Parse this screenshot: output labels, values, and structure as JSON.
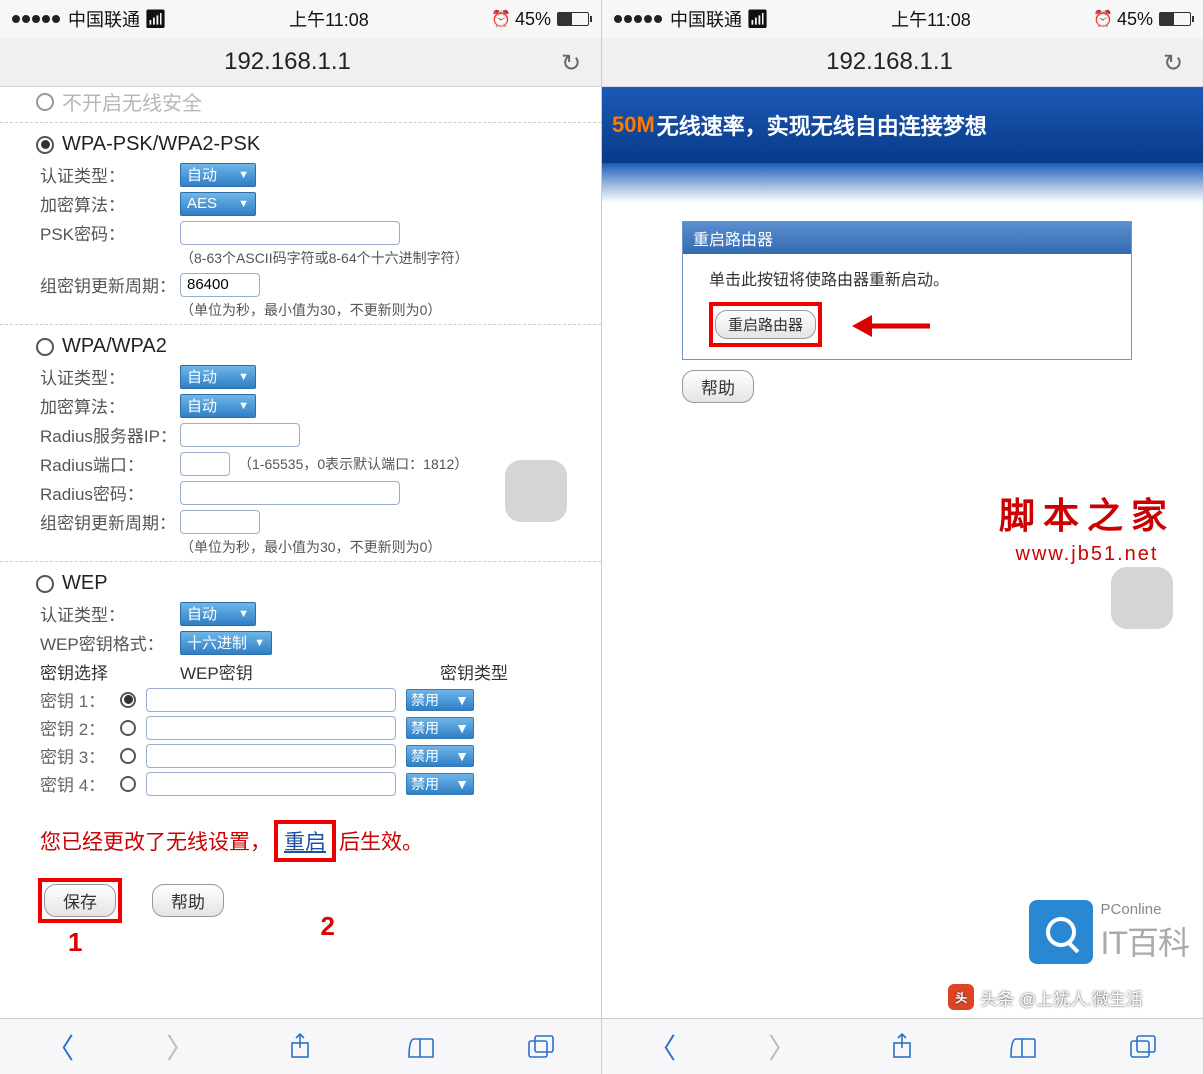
{
  "status": {
    "carrier": "中国联通",
    "time": "上午11:08",
    "battery": "45%",
    "alarm": "⏰"
  },
  "url": "192.168.1.1",
  "left": {
    "top_disabled": "不开启无线安全",
    "wpa_psk": {
      "title": "WPA-PSK/WPA2-PSK",
      "auth_label": "认证类型：",
      "auth_value": "自动",
      "enc_label": "加密算法：",
      "enc_value": "AES",
      "psk_label": "PSK密码：",
      "psk_value": "",
      "psk_hint": "（8-63个ASCII码字符或8-64个十六进制字符）",
      "group_label": "组密钥更新周期：",
      "group_value": "86400",
      "group_hint": "（单位为秒，最小值为30，不更新则为0）"
    },
    "wpa": {
      "title": "WPA/WPA2",
      "auth_label": "认证类型：",
      "auth_value": "自动",
      "enc_label": "加密算法：",
      "enc_value": "自动",
      "radius_ip_label": "Radius服务器IP：",
      "radius_ip_value": "",
      "radius_port_label": "Radius端口：",
      "radius_port_value": "",
      "radius_port_hint": "（1-65535，0表示默认端口：1812）",
      "radius_pw_label": "Radius密码：",
      "group_label": "组密钥更新周期：",
      "group_hint": "（单位为秒，最小值为30，不更新则为0）"
    },
    "wep": {
      "title": "WEP",
      "auth_label": "认证类型：",
      "auth_value": "自动",
      "fmt_label": "WEP密钥格式：",
      "fmt_value": "十六进制",
      "select_label": "密钥选择",
      "key_col": "WEP密钥",
      "type_col": "密钥类型",
      "k1": "密钥 1：",
      "k2": "密钥 2：",
      "k3": "密钥 3：",
      "k4": "密钥 4：",
      "disabled": "禁用"
    },
    "notice_pre": "您已经更改了无线设置，",
    "notice_link": "重启",
    "notice_post": "后生效。",
    "save": "保存",
    "help": "帮助",
    "annot1": "1",
    "annot2": "2"
  },
  "right": {
    "banner_speed": "50M",
    "banner_text": "无线速率，实现无线自由连接梦想",
    "panel_title": "重启路由器",
    "panel_info": "单击此按钮将使路由器重新启动。",
    "reboot_btn": "重启路由器",
    "help": "帮助",
    "watermark_cn": "脚本之家",
    "watermark_url": "www.jb51.net",
    "pconline_en": "PConline",
    "pconline_cn": "IT百科",
    "toutiao": "头条 @上犹人.微生活"
  }
}
